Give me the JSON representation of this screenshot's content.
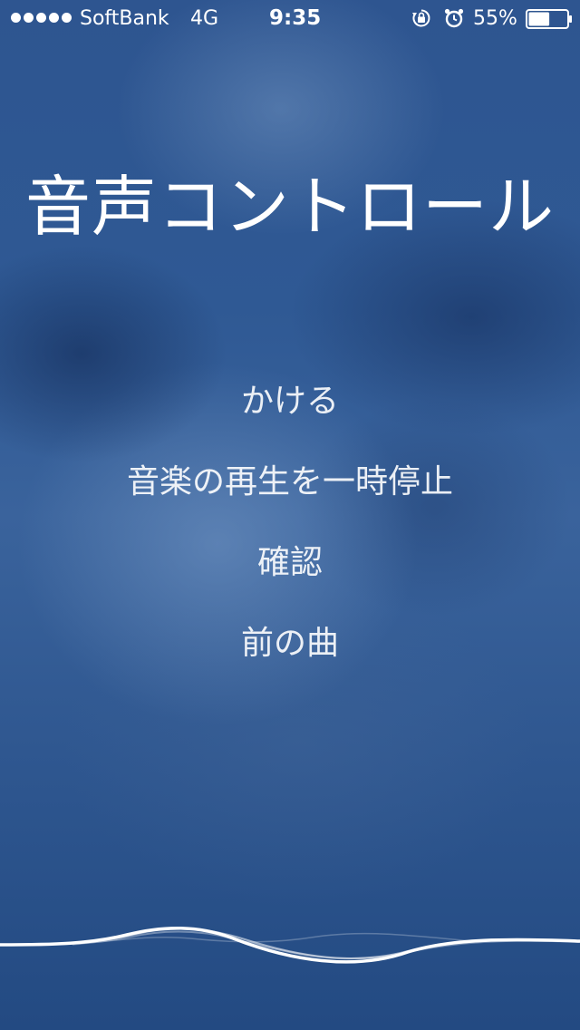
{
  "status_bar": {
    "carrier": "SoftBank",
    "network": "4G",
    "time": "9:35",
    "battery_percent_label": "55%",
    "battery_level": 0.55,
    "signal_bars": 5,
    "icons": [
      "rotation-lock-icon",
      "alarm-icon",
      "battery-icon"
    ]
  },
  "title": "音声コントロール",
  "commands": [
    "かける",
    "音楽の再生を一時停止",
    "確認",
    "前の曲"
  ],
  "colors": {
    "background": "#2f5994",
    "text": "#ffffff"
  }
}
